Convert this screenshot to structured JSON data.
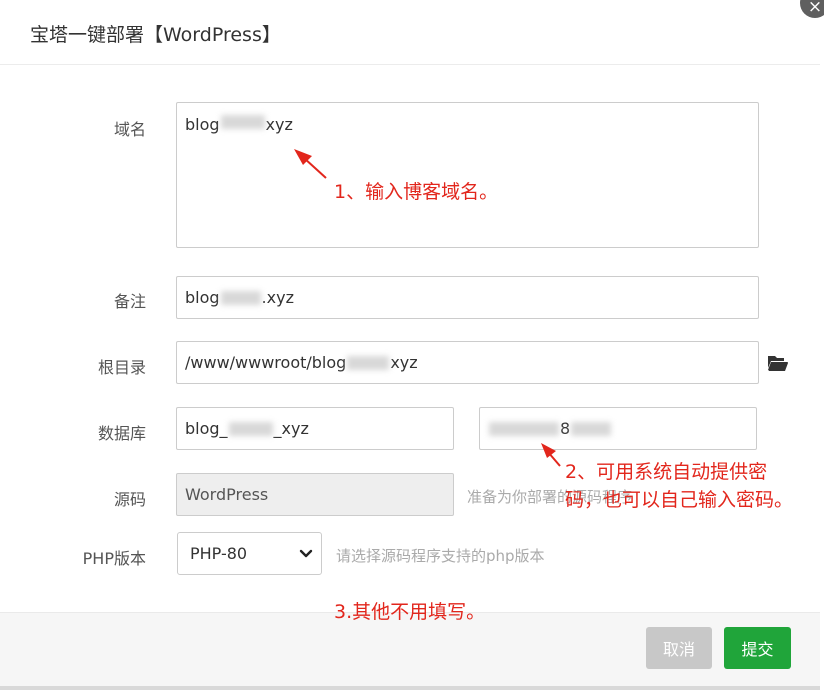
{
  "dialog": {
    "title": "宝塔一键部署【WordPress】",
    "close_label": "×"
  },
  "form": {
    "domain": {
      "label": "域名",
      "value_start": "blog",
      "value_end": "xyz"
    },
    "remark": {
      "label": "备注",
      "value_start": "blog",
      "value_end": ".xyz"
    },
    "root_dir": {
      "label": "根目录",
      "value_start": "/www/wwwroot/blog",
      "value_end": "xyz"
    },
    "database": {
      "label": "数据库",
      "name_start": "blog_",
      "name_end": "_xyz",
      "password_end": "8"
    },
    "source": {
      "label": "源码",
      "value": "WordPress",
      "hint": "准备为你部署的源码程序"
    },
    "php_version": {
      "label": "PHP版本",
      "selected": "PHP-80",
      "hint": "请选择源码程序支持的php版本"
    }
  },
  "annotations": {
    "note1": "1、输入博客域名。",
    "note2_line1": "2、可用系统自动提供密",
    "note2_line2": "码，也可以自己输入密码。",
    "note3": "3.其他不用填写。"
  },
  "footer": {
    "cancel_label": "取消",
    "submit_label": "提交"
  },
  "colors": {
    "accent": "#20a53a",
    "annotation": "#e2261c",
    "disabled": "#c8c8c8"
  },
  "icons": {
    "folder": "folder-open-icon",
    "dropdown": "chevron-down-icon",
    "close": "close-icon"
  }
}
